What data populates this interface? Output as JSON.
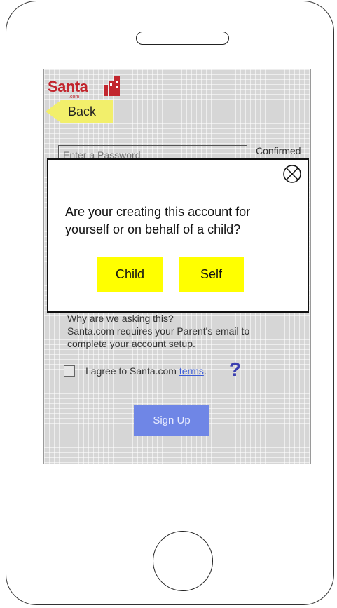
{
  "logo": {
    "name": "Santa",
    "sub": ".com"
  },
  "back_button": {
    "label": "Back"
  },
  "password_field": {
    "placeholder": "Enter a Password"
  },
  "confirmed_label": "Confirmed",
  "modal": {
    "question": "Are your creating this account for yourself or on behalf of a child?",
    "child_label": "Child",
    "self_label": "Self"
  },
  "info": {
    "line1": "Why are we asking this?",
    "line2": "Santa.com requires your Parent's email to",
    "line3": "complete your account setup."
  },
  "agree": {
    "prefix": "I agree to Santa.com ",
    "terms": "terms",
    "suffix": "."
  },
  "help_icon_glyph": "?",
  "signup_button": {
    "label": "Sign Up"
  },
  "colors": {
    "accent_yellow": "#ffff00",
    "signup_blue": "#6f86e6",
    "brand_red": "#c2262e",
    "link_blue": "#3a5bd6"
  },
  "icons": [
    "gift-stack-icon",
    "back-arrow-icon",
    "close-icon",
    "help-icon"
  ]
}
